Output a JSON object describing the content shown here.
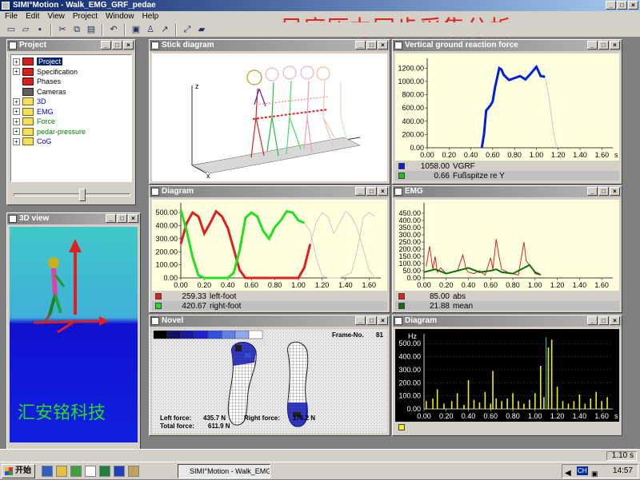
{
  "app": {
    "title": "SIMI°Motion - Walk_EMG_GRF_pedae",
    "banner": "足底压力同步采集分析"
  },
  "menu": [
    "File",
    "Edit",
    "View",
    "Project",
    "Window",
    "Help"
  ],
  "project": {
    "title": "Project",
    "items": [
      {
        "label": "Project",
        "selected": true,
        "color": "#000000"
      },
      {
        "label": "Specification",
        "color": "#000000"
      },
      {
        "label": "Phases",
        "color": "#000000"
      },
      {
        "label": "Cameras",
        "color": "#000000"
      },
      {
        "label": "3D",
        "color": "#0000c0"
      },
      {
        "label": "EMG",
        "color": "#0000c0"
      },
      {
        "label": "Force",
        "color": "#008000"
      },
      {
        "label": "pedar-pressure",
        "color": "#008000"
      },
      {
        "label": "CoG",
        "color": "#0000c0"
      }
    ]
  },
  "view3d": {
    "title": "3D view",
    "watermark": "汇安铭科技"
  },
  "stick": {
    "title": "Stick diagram",
    "axis_z": "z",
    "axis_x": "x"
  },
  "vgrf": {
    "title": "Vertical ground reaction force",
    "legend": [
      {
        "value": "1058.00",
        "label": "VGRF",
        "color": "#0020e0"
      },
      {
        "value": "0.66",
        "label": "Fußspitze re   Y",
        "color": "#20c020"
      }
    ]
  },
  "diagram": {
    "title": "Diagram",
    "legend": [
      {
        "value": "259.33",
        "label": "left-foot",
        "color": "#e02020"
      },
      {
        "value": "420.67",
        "label": "right-foot",
        "color": "#20e020"
      }
    ]
  },
  "emg": {
    "title": "EMG",
    "legend": [
      {
        "value": "85.00",
        "label": "abs",
        "color": "#e02020"
      },
      {
        "value": "21.88",
        "label": "mean",
        "color": "#107010"
      }
    ]
  },
  "novel": {
    "title": "Novel",
    "frame_label": "Frame-No.",
    "frame_value": "81",
    "left_force_label": "Left force:",
    "left_force_value": "435.7 N",
    "right_force_label": "Right force:",
    "right_force_value": "176.2 N",
    "total_force_label": "Total force:",
    "total_force_value": "611.9 N",
    "scale_colors": [
      "#000000",
      "#101060",
      "#1a1aa0",
      "#2020d0",
      "#3050e0",
      "#6080e8",
      "#90a8f0",
      "#ffffff"
    ]
  },
  "spectrum": {
    "title": "Diagram",
    "unit": "Hz",
    "legend_color": "#f0f000"
  },
  "status": {
    "time": "1.10 s"
  },
  "taskbar": {
    "start": "开始",
    "task": "SIMI°Motion - Walk_EMG...",
    "lang": "CH",
    "clock": "14:57"
  },
  "chart_data": [
    {
      "type": "line",
      "name": "Vertical ground reaction force",
      "xunit": "s",
      "xlim": [
        0,
        1.7
      ],
      "ylim": [
        0,
        1300
      ],
      "x_ticks": [
        0.0,
        0.2,
        0.4,
        0.6,
        0.8,
        1.0,
        1.2,
        1.4,
        1.6
      ],
      "y_ticks": [
        0.0,
        200.0,
        400.0,
        600.0,
        800.0,
        1000.0,
        1200.0
      ],
      "series": [
        {
          "name": "VGRF",
          "color": "#0020e0",
          "x": [
            0.5,
            0.52,
            0.54,
            0.56,
            0.58,
            0.6,
            0.62,
            0.64,
            0.66,
            0.68,
            0.7,
            0.75,
            0.8,
            0.85,
            0.9,
            0.95,
            1.0,
            1.04,
            1.08
          ],
          "y": [
            0,
            200,
            560,
            600,
            640,
            700,
            900,
            1050,
            1200,
            1180,
            1100,
            1020,
            1050,
            1080,
            1030,
            1120,
            1220,
            1080,
            1070
          ]
        },
        {
          "name": "VGRF (continued)",
          "color": "#c8c8c8",
          "x": [
            1.08,
            1.1,
            1.12,
            1.14,
            1.16,
            1.18,
            1.2
          ],
          "y": [
            1070,
            900,
            700,
            450,
            200,
            50,
            0
          ]
        }
      ]
    },
    {
      "type": "line",
      "name": "Diagram",
      "xlim": [
        0,
        1.7
      ],
      "ylim": [
        0,
        550
      ],
      "x_ticks": [
        0.0,
        0.2,
        0.4,
        0.6,
        0.8,
        1.0,
        1.2,
        1.4,
        1.6
      ],
      "y_ticks": [
        0.0,
        100.0,
        200.0,
        300.0,
        400.0,
        500.0
      ],
      "series": [
        {
          "name": "left-foot",
          "color": "#e02020",
          "x": [
            0.0,
            0.05,
            0.1,
            0.15,
            0.2,
            0.25,
            0.3,
            0.35,
            0.4,
            0.45,
            0.5,
            0.55,
            0.6,
            0.65,
            0.7,
            0.8,
            0.9,
            1.0,
            1.05,
            1.1
          ],
          "y": [
            260,
            420,
            500,
            470,
            340,
            420,
            510,
            470,
            380,
            220,
            60,
            0,
            0,
            0,
            0,
            0,
            0,
            0,
            80,
            259
          ]
        },
        {
          "name": "right-foot",
          "color": "#20e020",
          "x": [
            0.0,
            0.05,
            0.1,
            0.15,
            0.2,
            0.3,
            0.4,
            0.45,
            0.5,
            0.55,
            0.6,
            0.65,
            0.7,
            0.75,
            0.8,
            0.85,
            0.9,
            0.95,
            1.0,
            1.05
          ],
          "y": [
            520,
            360,
            160,
            20,
            0,
            0,
            0,
            40,
            210,
            460,
            500,
            470,
            360,
            300,
            390,
            440,
            510,
            500,
            440,
            421
          ]
        }
      ]
    },
    {
      "type": "line",
      "name": "EMG",
      "xlim": [
        0,
        1.7
      ],
      "ylim": [
        0,
        500
      ],
      "x_ticks": [
        0.0,
        0.2,
        0.4,
        0.6,
        0.8,
        1.0,
        1.2,
        1.4,
        1.6
      ],
      "y_ticks": [
        0.0,
        50.0,
        100.0,
        150.0,
        200.0,
        250.0,
        300.0,
        350.0,
        400.0,
        450.0
      ],
      "series": [
        {
          "name": "abs",
          "color": "#e02020",
          "x": [
            0.02,
            0.05,
            0.08,
            0.1,
            0.12,
            0.15,
            0.2,
            0.25,
            0.3,
            0.35,
            0.38,
            0.4,
            0.45,
            0.5,
            0.55,
            0.6,
            0.62,
            0.65,
            0.68,
            0.7,
            0.75,
            0.8,
            0.85,
            0.9,
            0.92,
            0.95,
            0.98,
            1.0,
            1.05
          ],
          "y": [
            80,
            220,
            60,
            150,
            40,
            70,
            30,
            40,
            50,
            160,
            60,
            40,
            30,
            50,
            20,
            140,
            60,
            270,
            130,
            60,
            40,
            30,
            20,
            250,
            120,
            90,
            60,
            30,
            20
          ]
        },
        {
          "name": "mean",
          "color": "#107010",
          "x": [
            0.0,
            0.1,
            0.2,
            0.3,
            0.4,
            0.5,
            0.6,
            0.65,
            0.7,
            0.8,
            0.9,
            0.95,
            1.0,
            1.05
          ],
          "y": [
            40,
            60,
            30,
            50,
            70,
            40,
            50,
            60,
            40,
            30,
            70,
            90,
            40,
            22
          ]
        }
      ]
    },
    {
      "type": "bar",
      "name": "Diagram",
      "yunit": "Hz",
      "xunit": "s",
      "xlim": [
        0,
        1.7
      ],
      "ylim": [
        0,
        550
      ],
      "x_ticks": [
        0.0,
        0.2,
        0.4,
        0.6,
        0.8,
        1.0,
        1.2,
        1.4,
        1.6
      ],
      "y_ticks": [
        0.0,
        100.0,
        200.0,
        300.0,
        400.0,
        500.0
      ],
      "series": [
        {
          "name": "spectrum",
          "color": "#f0f000",
          "x": [
            0.02,
            0.08,
            0.12,
            0.18,
            0.25,
            0.3,
            0.36,
            0.4,
            0.45,
            0.5,
            0.55,
            0.6,
            0.62,
            0.65,
            0.7,
            0.75,
            0.8,
            0.85,
            0.9,
            0.95,
            1.0,
            1.05,
            1.08,
            1.12,
            1.15,
            1.2,
            1.25,
            1.3,
            1.35,
            1.4,
            1.45,
            1.5,
            1.55,
            1.6,
            1.65
          ],
          "y": [
            60,
            80,
            150,
            40,
            60,
            120,
            30,
            220,
            70,
            50,
            130,
            40,
            290,
            80,
            60,
            80,
            120,
            60,
            40,
            70,
            120,
            330,
            90,
            470,
            530,
            170,
            60,
            40,
            60,
            110,
            40,
            80,
            130,
            60,
            90
          ]
        }
      ]
    }
  ]
}
